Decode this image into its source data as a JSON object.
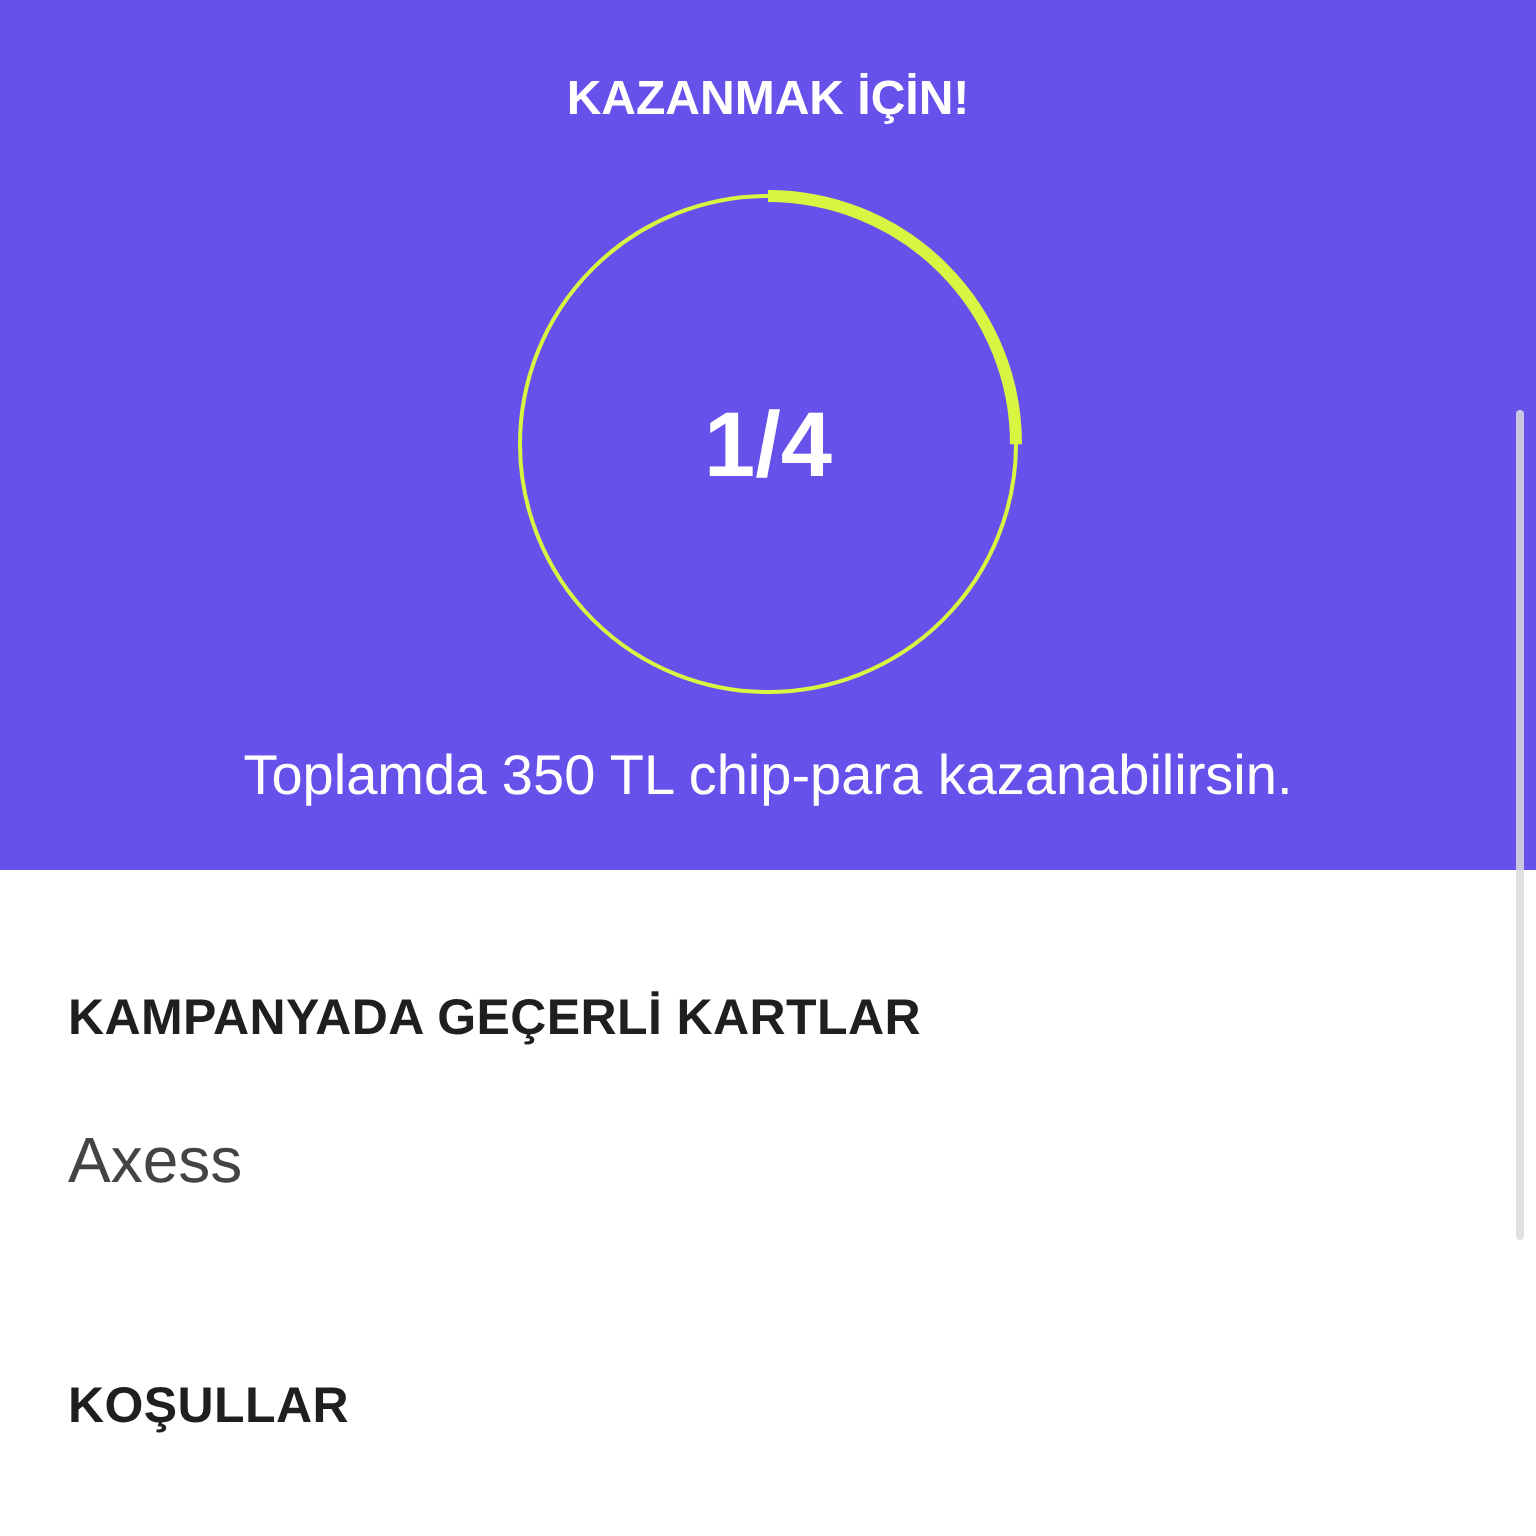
{
  "header": {
    "title": "KAZANMAK İÇİN!",
    "progress": {
      "text": "1/4",
      "level": 0.25
    },
    "subtitle": "Toplamda 350 TL chip-para kazanabilirsin."
  },
  "sections": [
    {
      "heading": "KAMPANYADA GEÇERLİ KARTLAR",
      "body": "Axess"
    },
    {
      "heading": "KOŞULLAR"
    }
  ]
}
